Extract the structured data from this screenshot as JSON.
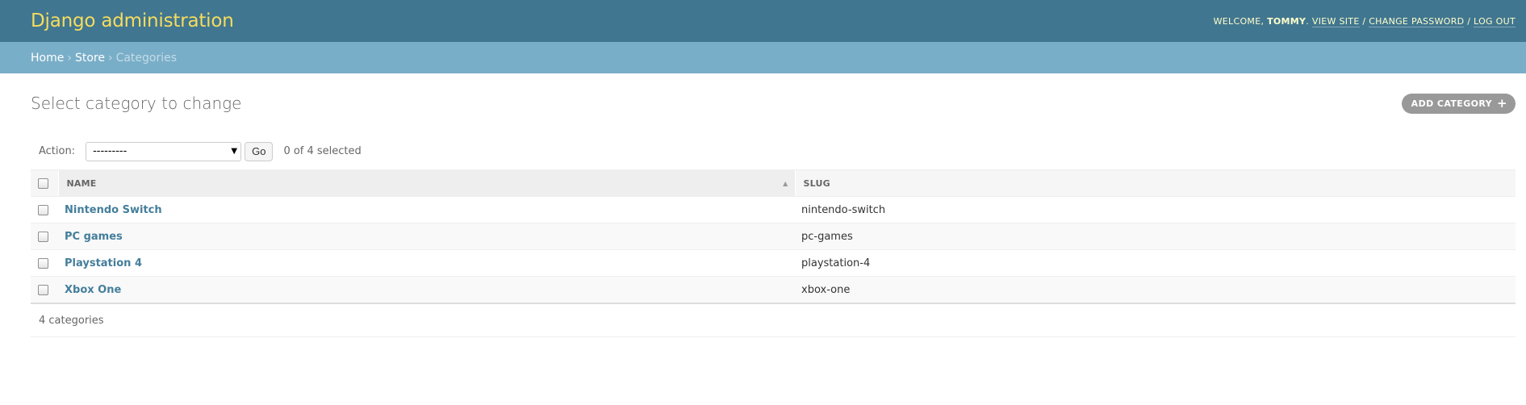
{
  "header": {
    "branding": "Django administration",
    "welcome": "Welcome,",
    "username": "Tommy",
    "view_site": "View site",
    "change_password": "Change password",
    "log_out": "Log out"
  },
  "breadcrumbs": {
    "home": "Home",
    "app": "Store",
    "current": "Categories"
  },
  "page": {
    "title": "Select category to change",
    "add_button": "Add category"
  },
  "actions": {
    "label": "Action:",
    "selected_value": "---------",
    "go": "Go",
    "counter": "0 of 4 selected"
  },
  "table": {
    "columns": [
      "Name",
      "Slug"
    ],
    "rows": [
      {
        "name": "Nintendo Switch",
        "slug": "nintendo-switch"
      },
      {
        "name": "PC games",
        "slug": "pc-games"
      },
      {
        "name": "Playstation 4",
        "slug": "playstation-4"
      },
      {
        "name": "Xbox One",
        "slug": "xbox-one"
      }
    ]
  },
  "paginator": "4 categories",
  "colors": {
    "header_bg": "#417690",
    "branding": "#f5dd5d",
    "breadcrumbs_bg": "#79aec8",
    "link": "#447e9b",
    "add_button_bg": "#999999"
  }
}
